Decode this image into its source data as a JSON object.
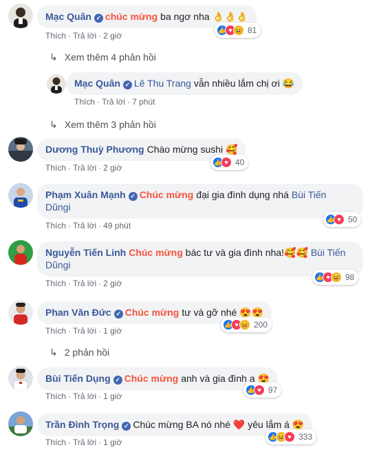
{
  "colors": {
    "name": "#385898",
    "tag": "#f5533d",
    "bubble": "#f2f3f5",
    "meta": "#606770"
  },
  "actions": {
    "like": "Thích",
    "reply": "Trả lời"
  },
  "comments": [
    {
      "name": "Mạc Quân",
      "verified": true,
      "tag": "chúc mừng",
      "text": "ba ngơ nha",
      "emoji": "👌👌👌",
      "time": "2 giờ",
      "reacts": [
        "like",
        "love",
        "haha"
      ],
      "count": "81"
    },
    {
      "more": "Xem thêm 4 phản hồi"
    },
    {
      "name": "Mạc Quân",
      "verified": true,
      "mention": "Lê Thu Trang",
      "text": "vẫn nhiều lắm chị ơi",
      "emoji": "😂",
      "time": "7 phút"
    },
    {
      "more": "Xem thêm 3 phản hồi"
    },
    {
      "name": "Dương Thuỳ Phương",
      "text": "Chào mừng sushi",
      "emoji": "🥰",
      "time": "2 giờ",
      "reacts": [
        "like",
        "love"
      ],
      "count": "40"
    },
    {
      "name": "Phạm Xuân Mạnh",
      "verified": true,
      "tag": "Chúc mừng",
      "text": "đại gia đình dụng nhá",
      "mention": "Bùi Tiến",
      "mention2": "Dũngi",
      "time": "49 phút",
      "reacts": [
        "like",
        "love"
      ],
      "count": "50"
    },
    {
      "name": "Nguyễn Tiến Linh",
      "tag": "Chúc mừng",
      "text": "bác tư và gia đình nha!",
      "emoji": "🥰🥰",
      "mention": "Bùi Tiến",
      "mention2": "Dũngi",
      "time": "2 giờ",
      "reacts": [
        "like",
        "love",
        "haha"
      ],
      "count": "98"
    },
    {
      "name": "Phan Văn Đức",
      "verified": true,
      "tag": "Chúc mừng",
      "text": "tư và gỡ nhé",
      "emoji": "😍😍",
      "time": "1 giờ",
      "reacts": [
        "like",
        "love",
        "haha"
      ],
      "count": "200"
    },
    {
      "more": "2 phản hồi"
    },
    {
      "name": "Bùi Tiến Dụng",
      "verified": true,
      "tag": "Chúc mừng",
      "text": "anh và gia đình a",
      "emoji": "😍",
      "time": "1 giờ",
      "reacts": [
        "like",
        "love"
      ],
      "count": "97"
    },
    {
      "name": "Trần Đình Trọng",
      "verified": true,
      "text": "Chúc mừng BA nó nhé",
      "emoji": "❤️",
      "text2": "yêu lắm á",
      "emoji2": "😍",
      "time": "1 giờ",
      "reacts": [
        "like",
        "haha",
        "love"
      ],
      "count": "333"
    }
  ]
}
